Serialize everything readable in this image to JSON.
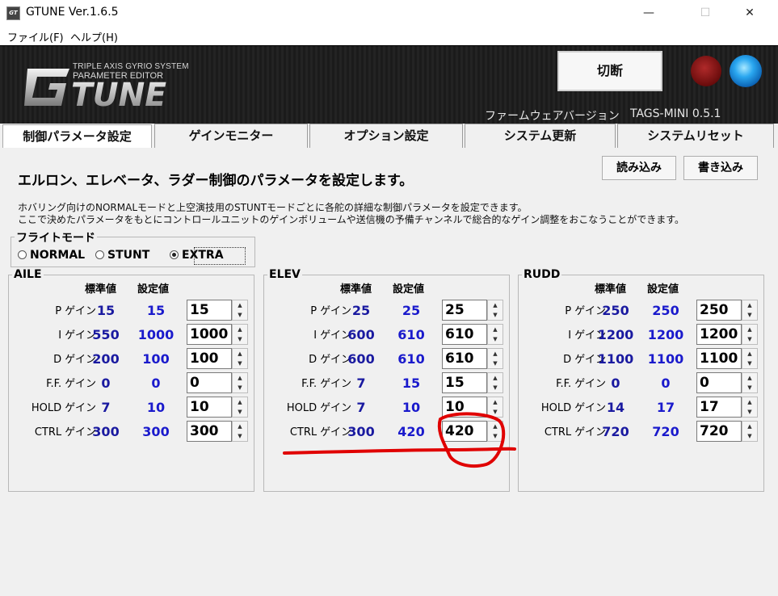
{
  "app": {
    "icon_text": "GT",
    "title": "GTUNE Ver.1.6.5"
  },
  "menu": {
    "file": "ファイル(F)",
    "help": "ヘルプ(H)"
  },
  "header": {
    "logo_line1": "TRIPLE AXIS GYRIO SYSTEM",
    "logo_line2": "PARAMETER EDITOR",
    "disconnect_label": "切断",
    "firmware_label": "ファームウェアバージョン",
    "firmware_value": "TAGS-MINI  0.5.1"
  },
  "tabs": [
    {
      "label": "制御パラメータ設定"
    },
    {
      "label": "ゲインモニター"
    },
    {
      "label": "オプション設定"
    },
    {
      "label": "システム更新"
    },
    {
      "label": "システムリセット"
    }
  ],
  "main": {
    "heading": "エルロン、エレベータ、ラダー制御のパラメータを設定します。",
    "desc_line1": "ホバリング向けのNORMALモードと上空演技用のSTUNTモードごとに各舵の詳細な制御パラメータを設定できます。",
    "desc_line2": "ここで決めたパラメータをもとにコントロールユニットのゲインボリュームや送信機の予備チャンネルで総合的なゲイン調整をおこなうことができます。",
    "load_label": "読み込み",
    "write_label": "書き込み"
  },
  "flight_mode": {
    "label": "フライトモード",
    "options": [
      "NORMAL",
      "STUNT",
      "EXTRA"
    ],
    "selected": "EXTRA"
  },
  "columns": {
    "standard": "標準値",
    "setting": "設定値"
  },
  "row_labels": [
    "P ゲイン",
    "I ゲイン",
    "D ゲイン",
    "F.F. ゲイン",
    "HOLD ゲイン",
    "CTRL ゲイン"
  ],
  "groups": [
    {
      "name": "AILE",
      "rows": [
        {
          "std": "15",
          "set": "15",
          "input": "15"
        },
        {
          "std": "550",
          "set": "1000",
          "input": "1000"
        },
        {
          "std": "200",
          "set": "100",
          "input": "100"
        },
        {
          "std": "0",
          "set": "0",
          "input": "0"
        },
        {
          "std": "7",
          "set": "10",
          "input": "10"
        },
        {
          "std": "300",
          "set": "300",
          "input": "300"
        }
      ]
    },
    {
      "name": "ELEV",
      "rows": [
        {
          "std": "25",
          "set": "25",
          "input": "25"
        },
        {
          "std": "600",
          "set": "610",
          "input": "610"
        },
        {
          "std": "600",
          "set": "610",
          "input": "610"
        },
        {
          "std": "7",
          "set": "15",
          "input": "15"
        },
        {
          "std": "7",
          "set": "10",
          "input": "10"
        },
        {
          "std": "300",
          "set": "420",
          "input": "420"
        }
      ]
    },
    {
      "name": "RUDD",
      "rows": [
        {
          "std": "250",
          "set": "250",
          "input": "250"
        },
        {
          "std": "1200",
          "set": "1200",
          "input": "1200"
        },
        {
          "std": "1100",
          "set": "1100",
          "input": "1100"
        },
        {
          "std": "0",
          "set": "0",
          "input": "0"
        },
        {
          "std": "14",
          "set": "17",
          "input": "17"
        },
        {
          "std": "720",
          "set": "720",
          "input": "720"
        }
      ]
    }
  ],
  "colors": {
    "std_value": "#1a1aa0",
    "set_value": "#1a1acc",
    "annotation": "#e00000",
    "led_blue": "#2aa7f0",
    "led_red": "#8a1010"
  },
  "icons": {
    "spin_up": "▲",
    "spin_down": "▼",
    "minimize": "—",
    "maximize": "☐",
    "close": "✕"
  }
}
